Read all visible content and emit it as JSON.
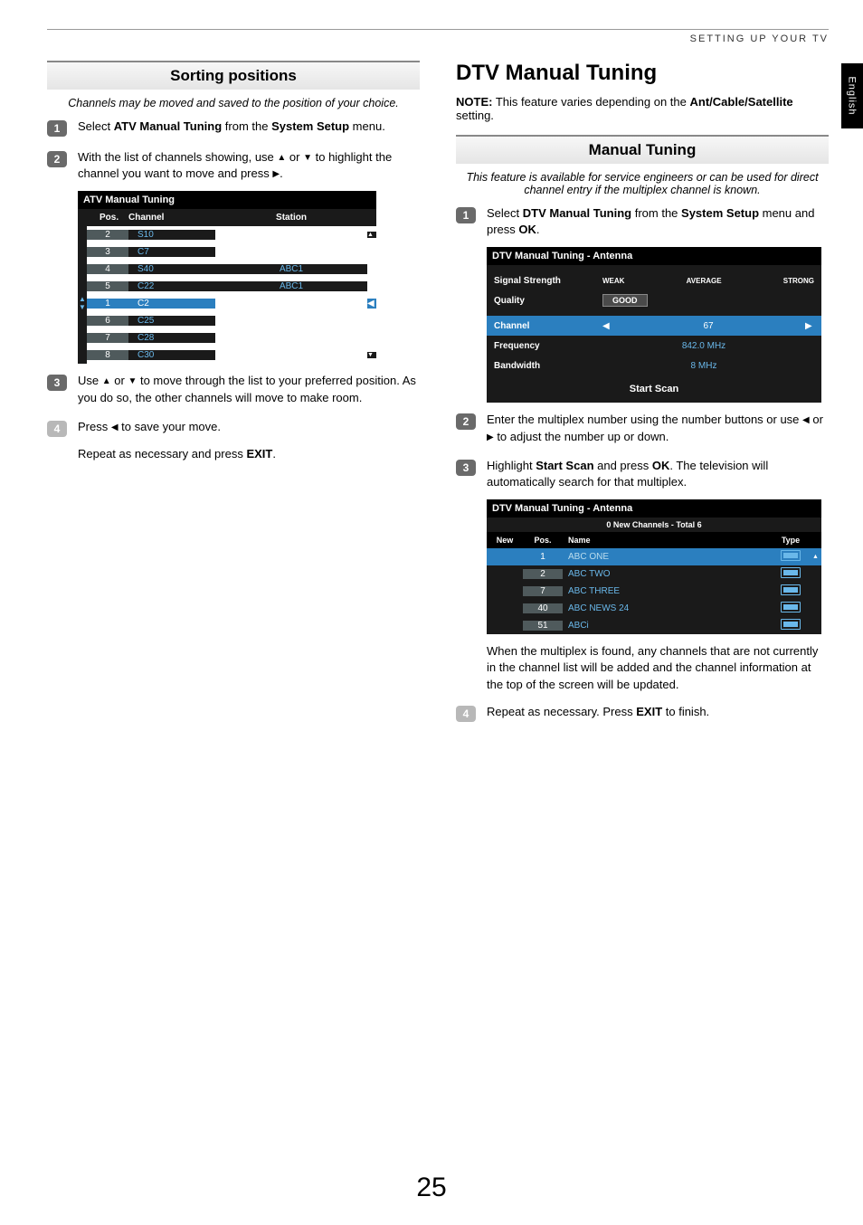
{
  "header": "SETTING UP YOUR TV",
  "lang_tab": "English",
  "page_number": "25",
  "left": {
    "section_title": "Sorting positions",
    "intro": "Channels may be moved and saved to the position of your choice.",
    "step1a": "Select ",
    "step1b": "ATV Manual Tuning",
    "step1c": " from the ",
    "step1d": "System Setup",
    "step1e": " menu.",
    "step2a": "With the list of channels showing, use ",
    "step2b": " or ",
    "step2c": " to highlight the channel you want to move and press ",
    "step2d": ".",
    "step3a": "Use ",
    "step3b": " or ",
    "step3c": " to move through the list to your preferred position. As you do so, the other channels will move to make room.",
    "step4a": "Press ",
    "step4b": " to save your move.",
    "repeat_a": "Repeat as necessary and press ",
    "repeat_b": "EXIT",
    "repeat_c": ".",
    "osd": {
      "title": "ATV Manual Tuning",
      "col_pos": "Pos.",
      "col_channel": "Channel",
      "col_station": "Station",
      "rows": [
        {
          "pos": "2",
          "ch": "S10",
          "st": ""
        },
        {
          "pos": "3",
          "ch": "C7",
          "st": ""
        },
        {
          "pos": "4",
          "ch": "S40",
          "st": "ABC1"
        },
        {
          "pos": "5",
          "ch": "C22",
          "st": "ABC1"
        },
        {
          "pos": "1",
          "ch": "C2",
          "st": "",
          "sel": true
        },
        {
          "pos": "6",
          "ch": "C25",
          "st": ""
        },
        {
          "pos": "7",
          "ch": "C28",
          "st": ""
        },
        {
          "pos": "8",
          "ch": "C30",
          "st": ""
        }
      ]
    }
  },
  "right": {
    "main_title": "DTV Manual Tuning",
    "note_label": "NOTE:",
    "note_a": " This feature varies depending on the ",
    "note_b": "Ant/Cable/Satellite",
    "note_c": " setting.",
    "section_title": "Manual Tuning",
    "intro": "This feature is available for service engineers or can be used for direct channel entry if the multiplex channel is known.",
    "step1a": "Select ",
    "step1b": "DTV Manual Tuning",
    "step1c": " from the ",
    "step1d": "System Setup",
    "step1e": " menu and press ",
    "step1f": "OK",
    "step1g": ".",
    "step2a": "Enter the multiplex number using the number buttons or use ",
    "step2b": " or ",
    "step2c": " to adjust the number up or down.",
    "step3a": "Highlight ",
    "step3b": "Start Scan",
    "step3c": " and press ",
    "step3d": "OK",
    "step3e": ". The television will automatically search for that multiplex.",
    "found_text": "When the multiplex is found, any channels that are not currently in the channel list will be added and the channel information at the top of the screen will be updated.",
    "step4a": "Repeat as necessary. Press ",
    "step4b": "EXIT",
    "step4c": " to finish.",
    "osd1": {
      "title": "DTV Manual Tuning - Antenna",
      "signal": "Signal Strength",
      "quality": "Quality",
      "weak": "WEAK",
      "average": "AVERAGE",
      "strong": "STRONG",
      "good": "GOOD",
      "channel": "Channel",
      "channel_val": "67",
      "freq": "Frequency",
      "freq_val": "842.0 MHz",
      "bw": "Bandwidth",
      "bw_val": "8 MHz",
      "scan": "Start Scan"
    },
    "osd2": {
      "title": "DTV Manual Tuning - Antenna",
      "summary": "0 New Channels - Total 6",
      "col_new": "New",
      "col_pos": "Pos.",
      "col_name": "Name",
      "col_type": "Type",
      "rows": [
        {
          "pos": "1",
          "name": "ABC ONE",
          "sel": true
        },
        {
          "pos": "2",
          "name": "ABC TWO"
        },
        {
          "pos": "7",
          "name": "ABC THREE"
        },
        {
          "pos": "40",
          "name": "ABC NEWS 24"
        },
        {
          "pos": "51",
          "name": "ABCi"
        }
      ]
    }
  }
}
